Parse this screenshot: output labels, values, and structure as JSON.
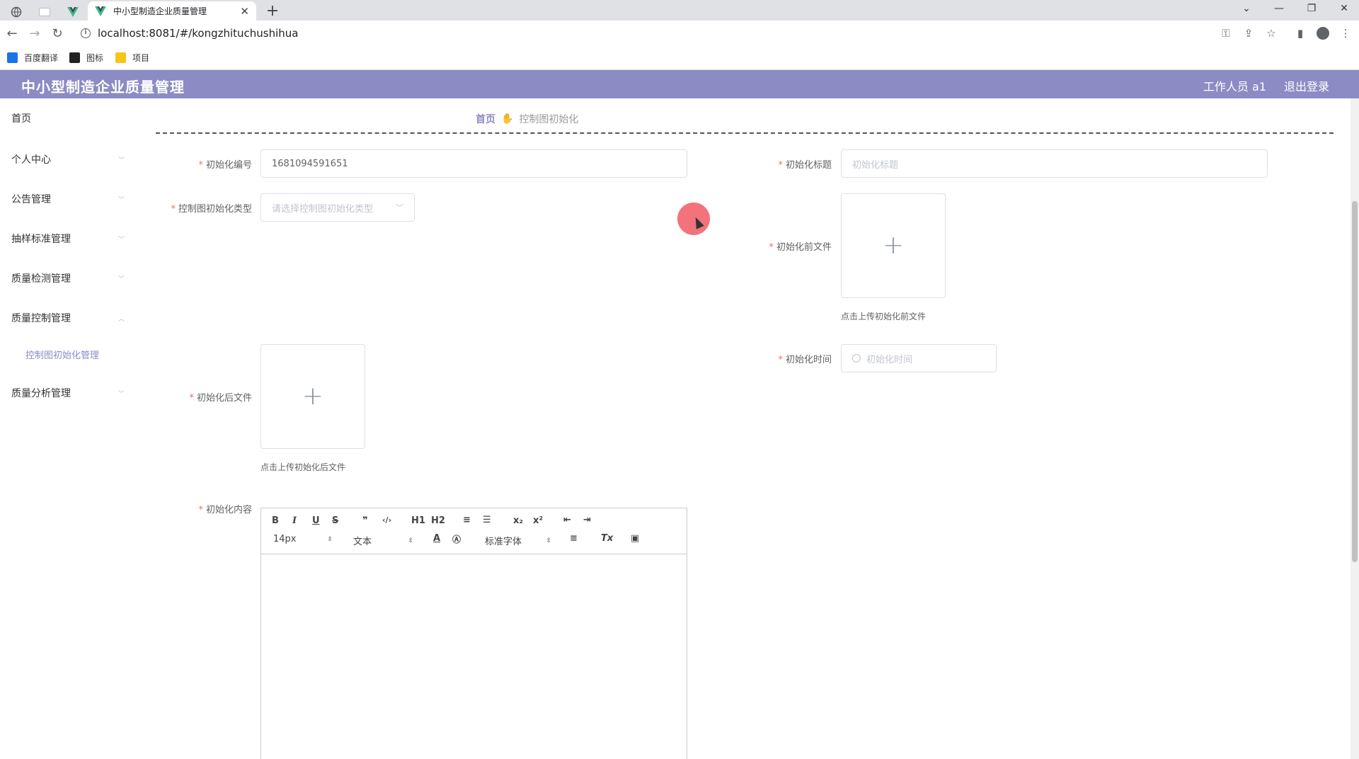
{
  "browser": {
    "active_tab_title": "中小型制造企业质量管理",
    "url": "localhost:8081/#/kongzhituchushihua",
    "bookmarks": [
      {
        "label": "百度翻译",
        "color": "#1a73e8"
      },
      {
        "label": "图标",
        "color": "#222222"
      },
      {
        "label": "项目",
        "color": "#f5c518"
      }
    ]
  },
  "header": {
    "title": "中小型制造企业质量管理",
    "user": "工作人员 a1",
    "logout": "退出登录",
    "bg_color": "#8c8bc3"
  },
  "sidebar": {
    "items": [
      {
        "label": "首页"
      },
      {
        "label": "个人中心"
      },
      {
        "label": "公告管理"
      },
      {
        "label": "抽样标准管理"
      },
      {
        "label": "质量检测管理"
      },
      {
        "label": "质量控制管理"
      },
      {
        "label": "质量分析管理"
      }
    ],
    "active_sub": "控制图初始化管理"
  },
  "breadcrumb": {
    "home": "首页",
    "current": "控制图初始化"
  },
  "form": {
    "code_label": "初始化编号",
    "code_value": "1681094591651",
    "title_label": "初始化标题",
    "title_placeholder": "初始化标题",
    "type_label": "控制图初始化类型",
    "type_placeholder": "请选择控制图初始化类型",
    "before_file_label": "初始化前文件",
    "before_file_hint": "点击上传初始化前文件",
    "time_label": "初始化时间",
    "time_placeholder": "初始化时间",
    "after_file_label": "初始化后文件",
    "after_file_hint": "点击上传初始化后文件",
    "content_label": "初始化内容",
    "required_mark": "*"
  },
  "editor": {
    "row1": [
      "B",
      "I",
      "U",
      "S",
      "❞",
      "‹/›",
      "H1",
      "H2",
      "≡",
      "☰",
      "x₂",
      "x²",
      "⇤",
      "⇥"
    ],
    "font_size": "14px",
    "text_type": "文本",
    "font_family": "标准字体"
  }
}
